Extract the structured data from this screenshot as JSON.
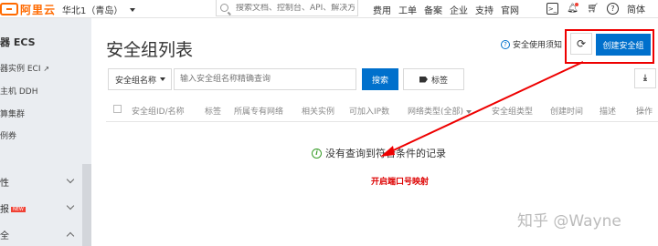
{
  "topbar": {
    "logo_text": "阿里云",
    "region": "华北1（青岛）",
    "search_placeholder": "搜索文档、控制台、API、解决方案和资源",
    "nav": [
      "费用",
      "工单",
      "备案",
      "企业",
      "支持",
      "官网"
    ],
    "lang": "简体"
  },
  "sidebar": {
    "title": "器 ECS",
    "items": [
      "器实例 ECI",
      "主机 DDH",
      "算集群",
      "例券"
    ],
    "groups": [
      "性",
      "报",
      "全"
    ],
    "new_tag": "NEW"
  },
  "main": {
    "title": "安全组列表",
    "help_link": "安全使用须知",
    "create_button": "创建安全组",
    "filter_select": "安全组名称",
    "filter_placeholder": "输入安全组名称精确查询",
    "search_button": "搜索",
    "tag_button": "标签",
    "columns": [
      "安全组ID/名称",
      "标签",
      "所属专有网络",
      "相关实例",
      "可加入IP数",
      "网络类型(全部)",
      "安全组类型",
      "创建时间",
      "描述",
      "操作"
    ],
    "empty_message": "没有查询到符合条件的记录"
  },
  "annotation": {
    "text": "开启端口号映射",
    "color": "#dd0000"
  },
  "watermark": "知乎 @Wayne",
  "colors": {
    "brand": "#ff6a00",
    "primary": "#0070cc",
    "highlight": "#ee0000"
  }
}
